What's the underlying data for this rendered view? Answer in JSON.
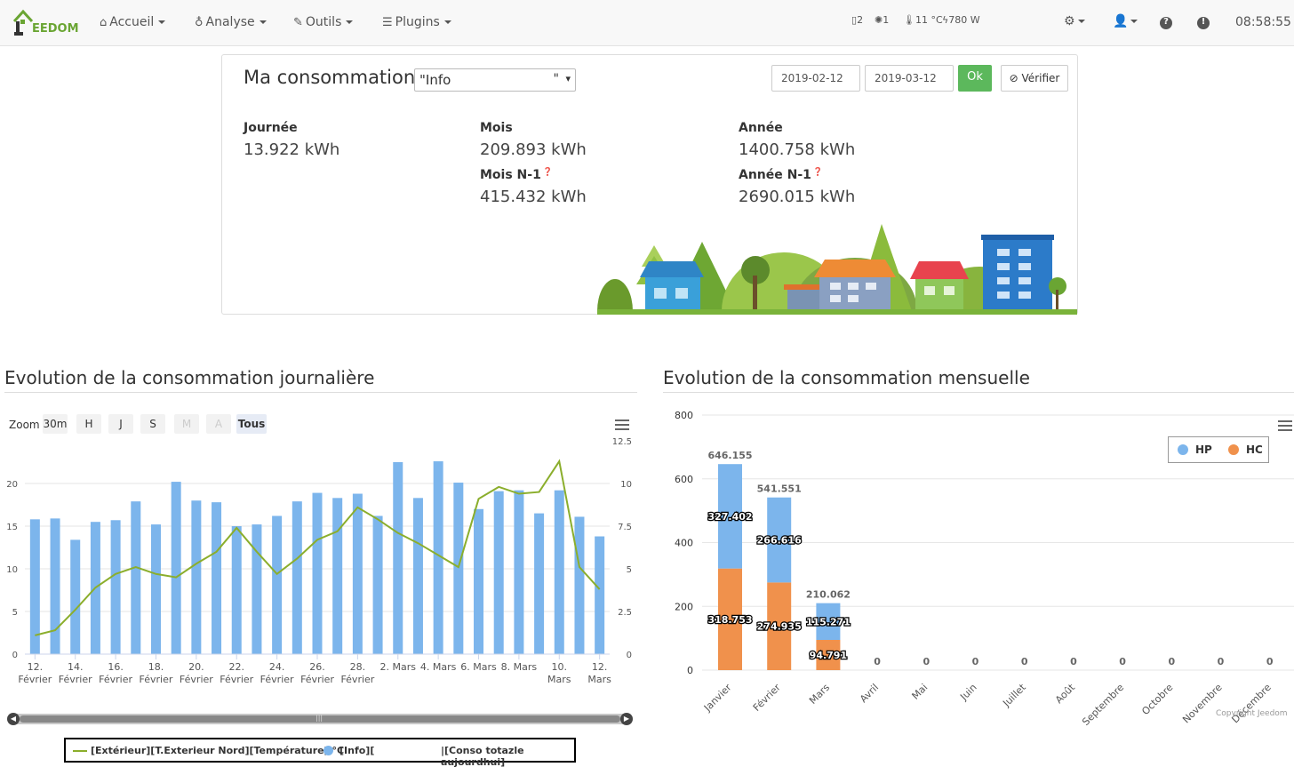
{
  "navbar": {
    "logo_text": "EEDOM",
    "menu": [
      {
        "label": "Accueil",
        "icon": "home-icon"
      },
      {
        "label": "Analyse",
        "icon": "stethoscope-icon"
      },
      {
        "label": "Outils",
        "icon": "wrench-icon"
      },
      {
        "label": "Plugins",
        "icon": "list-icon"
      }
    ],
    "status": {
      "doors": "2",
      "lights": "1",
      "temp": "11 °C",
      "power": "780 W"
    },
    "clock": "08:58:55"
  },
  "summary": {
    "title": "Ma consommation",
    "select_value": "\"Info",
    "select_suffix": "\"",
    "date_from": "2019-02-12",
    "date_to": "2019-03-12",
    "ok_label": "Ok",
    "verify_label": "Vérifier",
    "day_label": "Journée",
    "day_value": "13.922 kWh",
    "month_label": "Mois",
    "month_value": "209.893 kWh",
    "prev_month_label": "Mois N-1",
    "prev_month_value": "415.432 kWh",
    "year_label": "Année",
    "year_value": "1400.758 kWh",
    "prev_year_label": "Année N-1",
    "prev_year_value": "2690.015 kWh"
  },
  "daily": {
    "title": "Evolution de la consommation journalière",
    "zoom_label": "Zoom",
    "zoom_buttons": [
      "30m",
      "H",
      "J",
      "S",
      "M",
      "A",
      "Tous"
    ],
    "legend": {
      "temp": "[Extérieur][T.Exterieur Nord][Température] °C",
      "info": "[Info][",
      "total": "|[Conso totazle aujourdhui]"
    }
  },
  "monthly": {
    "title": "Evolution de la consommation mensuelle",
    "legend": {
      "hp": "HP",
      "hc": "HC"
    },
    "copyright": "Copyright Jeedom"
  },
  "colors": {
    "bar_blue": "#7cb5ec",
    "line_green": "#8bae2c",
    "bar_orange": "#f0914c",
    "ok_green": "#5cb85c"
  },
  "chart_data": [
    {
      "type": "bar",
      "title": "Evolution de la consommation journalière",
      "x_tick_labels": [
        [
          "12.",
          "Février"
        ],
        [
          "14.",
          "Février"
        ],
        [
          "16.",
          "Février"
        ],
        [
          "18.",
          "Février"
        ],
        [
          "20.",
          "Février"
        ],
        [
          "22.",
          "Février"
        ],
        [
          "24.",
          "Février"
        ],
        [
          "26.",
          "Février"
        ],
        [
          "28.",
          "Février"
        ],
        [
          "2. Mars",
          ""
        ],
        [
          "4. Mars",
          ""
        ],
        [
          "6. Mars",
          ""
        ],
        [
          "8. Mars",
          ""
        ],
        [
          "10.",
          "Mars"
        ],
        [
          "12.",
          "Mars"
        ]
      ],
      "y_left_ticks": [
        "0",
        "5",
        "10",
        "15",
        "20"
      ],
      "y_right_ticks": [
        "0",
        "2.5",
        "5",
        "7.5",
        "10",
        "12.5"
      ],
      "ylim_left": [
        0,
        25
      ],
      "ylim_right": [
        0,
        12.5
      ],
      "series": [
        {
          "name": "[Info][",
          "type": "column",
          "axis": "left",
          "values": [
            15.8,
            15.9,
            13.4,
            15.5,
            15.7,
            17.9,
            15.2,
            20.2,
            18.0,
            17.8,
            15.0,
            15.2,
            16.2,
            17.9,
            18.9,
            18.3,
            18.8,
            16.2,
            22.5,
            18.3,
            22.6,
            20.1,
            17.0,
            19.1,
            19.2,
            16.5,
            19.2,
            16.1,
            13.8
          ]
        },
        {
          "name": "[Extérieur][T.Exterieur Nord][Température] °C",
          "type": "line",
          "axis": "right",
          "values": [
            1.1,
            1.4,
            2.6,
            3.9,
            4.7,
            5.1,
            4.7,
            4.5,
            5.3,
            6.0,
            7.4,
            6.0,
            4.7,
            5.6,
            6.7,
            7.2,
            8.6,
            7.9,
            7.1,
            6.5,
            5.8,
            5.1,
            9.1,
            9.8,
            9.4,
            9.5,
            11.3,
            5.1,
            3.8
          ]
        }
      ]
    },
    {
      "type": "bar",
      "title": "Evolution de la consommation mensuelle",
      "categories": [
        "Janvier",
        "Février",
        "Mars",
        "Avril",
        "Mai",
        "Juin",
        "Juillet",
        "Août",
        "Septembre",
        "Octobre",
        "Novembre",
        "Décembre"
      ],
      "y_ticks": [
        "0",
        "200",
        "400",
        "600",
        "800"
      ],
      "ylim": [
        0,
        800
      ],
      "stacked": true,
      "totals": [
        "646.155",
        "541.551",
        "210.062",
        "0",
        "0",
        "0",
        "0",
        "0",
        "0",
        "0",
        "0",
        "0"
      ],
      "series": [
        {
          "name": "HP",
          "values": [
            327.402,
            266.616,
            115.271,
            0,
            0,
            0,
            0,
            0,
            0,
            0,
            0,
            0
          ],
          "labels": [
            "327.402",
            "266.616",
            "115.271"
          ]
        },
        {
          "name": "HC",
          "values": [
            318.753,
            274.935,
            94.791,
            0,
            0,
            0,
            0,
            0,
            0,
            0,
            0,
            0
          ],
          "labels": [
            "318.753",
            "274.935",
            "94.791"
          ]
        }
      ],
      "legend_position": "top-right"
    }
  ]
}
